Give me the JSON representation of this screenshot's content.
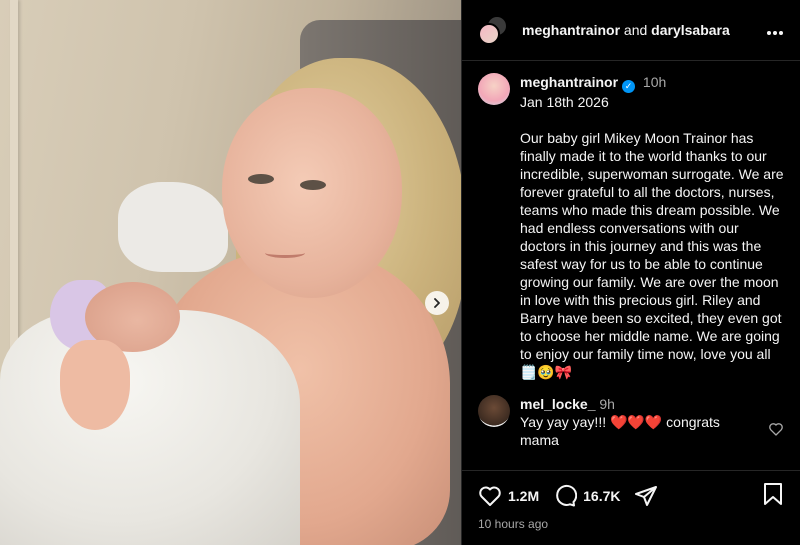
{
  "header": {
    "user1": "meghantrainor",
    "and": "and",
    "user2": "darylsabara",
    "more_icon": "more-horizontal-icon"
  },
  "caption": {
    "username": "meghantrainor",
    "verified": true,
    "time": "10h",
    "date": "Jan 18th 2026",
    "text": "Our baby girl Mikey Moon Trainor has finally made it to the world thanks to our incredible, superwoman surrogate. We are forever grateful to all the doctors, nurses, teams who made this dream possible. We had endless conversations with our doctors in this journey and this was the safest way for us to be able to continue growing our family. We are over the moon in love with this precious girl. Riley and Barry have been so excited, they even got to choose her middle name. We are going to enjoy our family time now, love you all🗒️🥹🎀"
  },
  "comments": [
    {
      "username": "mel_locke_",
      "time": "9h",
      "text": "Yay yay yay!!! ❤️❤️❤️ congrats mama"
    }
  ],
  "actions": {
    "likes": "1.2M",
    "comments": "16.7K",
    "posted_ago": "10 hours ago"
  },
  "colors": {
    "background": "#000000",
    "verified": "#0095f6",
    "secondary_text": "#a8a8a8"
  }
}
